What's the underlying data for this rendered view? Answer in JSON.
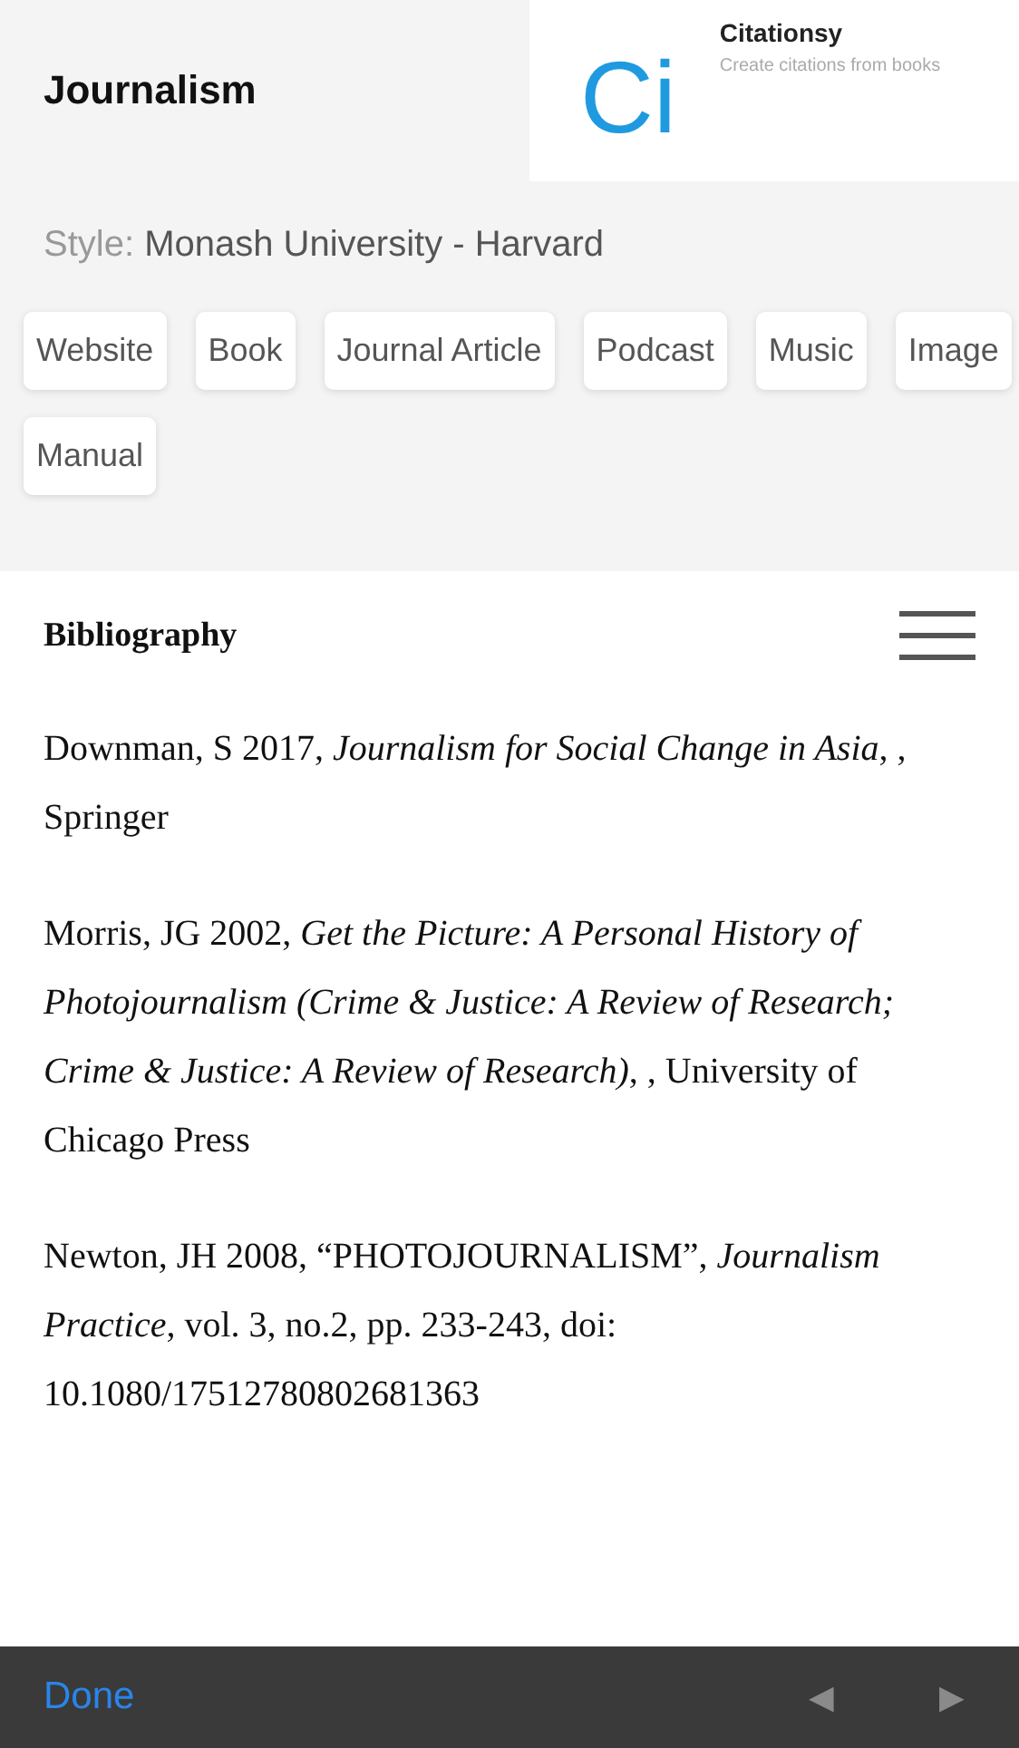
{
  "header": {
    "title": "Journalism"
  },
  "ad": {
    "logo": "Ci",
    "name": "Citationsy",
    "tagline": "Create citations from books"
  },
  "style": {
    "label": "Style:",
    "value": "Monash University - Harvard"
  },
  "source_types": [
    "Website",
    "Book",
    "Journal Article",
    "Podcast",
    "Music",
    "Image",
    "Manual"
  ],
  "bibliography": {
    "title": "Bibliography",
    "entries": [
      "Downman, S 2017, *Journalism for Social Change in Asia*, , Springer",
      "Morris, JG 2002, *Get the Picture: A Personal History of Photojournalism (Crime & Justice: A Review of Research; Crime & Justice: A Review of Research)*, , University of Chicago Press",
      "Newton, JH 2008, “PHOTOJOURNALISM”, *Journalism Practice*, vol. 3, no.2, pp. 233-243, doi: 10.1080/17512780802681363"
    ]
  },
  "toolbar": {
    "done": "Done",
    "arrows": [
      {
        "label": "◀",
        "disabled": true
      },
      {
        "label": "▶",
        "disabled": true
      }
    ]
  }
}
